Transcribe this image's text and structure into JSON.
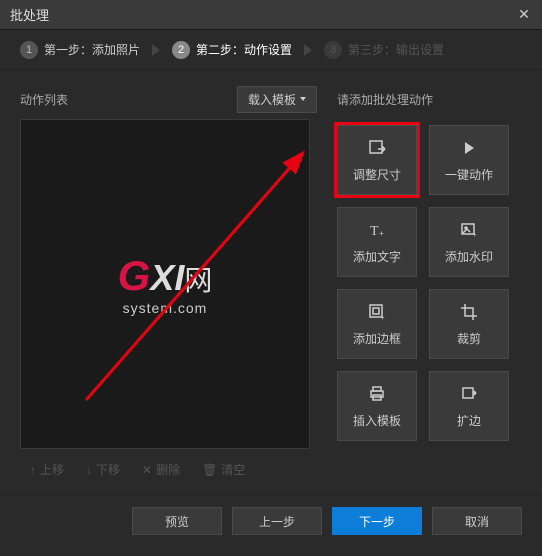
{
  "window": {
    "title": "批处理"
  },
  "steps": {
    "step1": "第一步：添加照片",
    "step2": "第二步：动作设置",
    "step3": "第三步：输出设置"
  },
  "left": {
    "title": "动作列表",
    "template_btn": "载入模板",
    "toolbar": {
      "up": "上移",
      "down": "下移",
      "delete": "删除",
      "clear": "清空"
    }
  },
  "right": {
    "title": "请添加批处理动作",
    "actions": {
      "resize": "调整尺寸",
      "onekey": "一键动作",
      "text": "添加文字",
      "watermark": "添加水印",
      "border": "添加边框",
      "crop": "裁剪",
      "template": "插入模板",
      "expand": "扩边"
    }
  },
  "footer": {
    "preview": "预览",
    "prev": "上一步",
    "next": "下一步",
    "cancel": "取消"
  }
}
